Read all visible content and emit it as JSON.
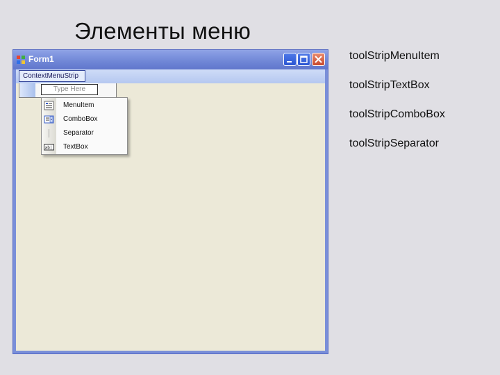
{
  "slide": {
    "title": "Элементы меню",
    "bullets": [
      "toolStripMenuItem",
      "toolStripTextBox",
      "toolStripComboBox",
      "toolStripSeparator"
    ]
  },
  "window": {
    "title": "Form1",
    "icon": "app-icon",
    "controls": [
      "minimize-icon",
      "maximize-icon",
      "close-icon"
    ]
  },
  "designer": {
    "strip_tab_label": "ContextMenuStrip",
    "type_here_placeholder": "Type Here",
    "dropdown_items": [
      {
        "label": "MenuItem",
        "icon": "menu-item-icon"
      },
      {
        "label": "ComboBox",
        "icon": "combo-box-icon"
      },
      {
        "label": "Separator",
        "icon": "separator-icon"
      },
      {
        "label": "TextBox",
        "icon": "text-box-icon"
      }
    ]
  },
  "colors": {
    "slide_bg": "#e0dfe4",
    "title_bar": "#6f86d6",
    "client_bg": "#ece9d8",
    "close_button": "#c7482c"
  }
}
